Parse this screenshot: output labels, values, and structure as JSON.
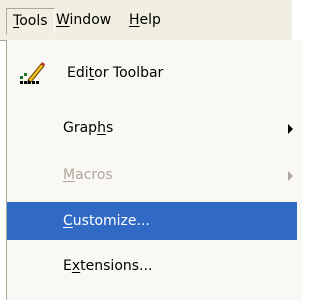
{
  "menubar": {
    "tools": {
      "first": "T",
      "rest": "ools"
    },
    "window": {
      "first": "W",
      "rest": "indow"
    },
    "help": {
      "first": "H",
      "rest": "elp"
    }
  },
  "menu": {
    "items": [
      {
        "pre": "Edi",
        "ul": "t",
        "post": "or Toolbar",
        "icon": "pencil-chart-icon"
      },
      {
        "pre": "Grap",
        "ul": "h",
        "post": "s",
        "submenu": true
      },
      {
        "pre": "",
        "ul": "M",
        "post": "acros",
        "submenu": true,
        "disabled": true
      },
      {
        "pre": "",
        "ul": "C",
        "post": "ustomize...",
        "selected": true
      },
      {
        "pre": "E",
        "ul": "x",
        "post": "tensions..."
      }
    ]
  },
  "colors": {
    "menubar_bg": "#f1efe2",
    "menu_bg": "#f9f8f4",
    "highlight": "#316ac5",
    "disabled_text": "#aca899"
  }
}
